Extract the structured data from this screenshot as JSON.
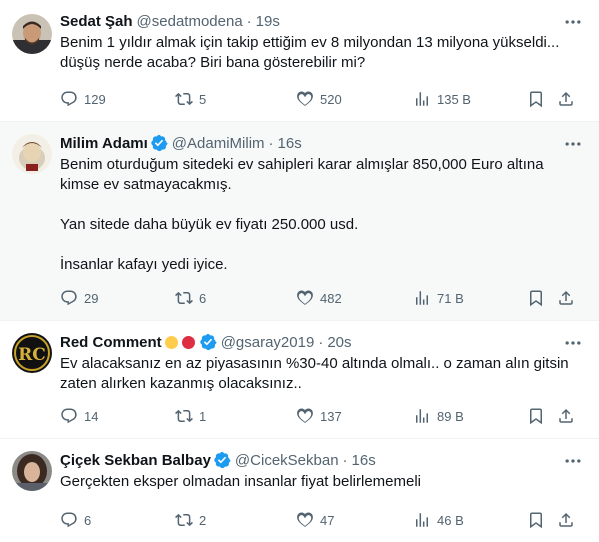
{
  "tweets": [
    {
      "name": "Sedat Şah",
      "handle": "@sedatmodena",
      "time": "19s",
      "verified": false,
      "text": "Benim 1 yıldır almak için takip ettiğim ev 8 milyondan 13 milyona yükseldi...\ndüşüş nerde acaba? Biri bana gösterebilir mi?",
      "replies": "129",
      "retweets": "5",
      "likes": "520",
      "views": "135 B"
    },
    {
      "name": "Milim Adamı",
      "handle": "@AdamiMilim",
      "time": "16s",
      "verified": true,
      "text": "Benim oturduğum sitedeki ev sahipleri karar almışlar 850,000 Euro altına\nkimse ev satmayacakmış.\n\nYan sitede daha büyük ev fiyatı 250.000 usd.\n\nİnsanlar kafayı yedi iyice.",
      "replies": "29",
      "retweets": "6",
      "likes": "482",
      "views": "71 B"
    },
    {
      "name": "Red Comment",
      "handle": "@gsaray2019",
      "time": "20s",
      "verified": true,
      "name_emojis": [
        "yellow-circle",
        "red-circle"
      ],
      "text": "Ev alacaksanız en az piyasasının %30-40 altında olmalı.. o zaman alın gitsin\nzaten alırken kazanmış olacaksınız..",
      "replies": "14",
      "retweets": "1",
      "likes": "137",
      "views": "89 B"
    },
    {
      "name": "Çiçek Sekban Balbay",
      "handle": "@CicekSekban",
      "time": "16s",
      "verified": true,
      "text": "Gerçekten eksper olmadan insanlar fiyat belirlememeli",
      "replies": "6",
      "retweets": "2",
      "likes": "47",
      "views": "46 B"
    }
  ],
  "colors": {
    "text": "#0f1419",
    "secondary": "#536471",
    "verified": "#1d9bf0",
    "yellow": "#ffcc4d",
    "red": "#dd2e44"
  }
}
